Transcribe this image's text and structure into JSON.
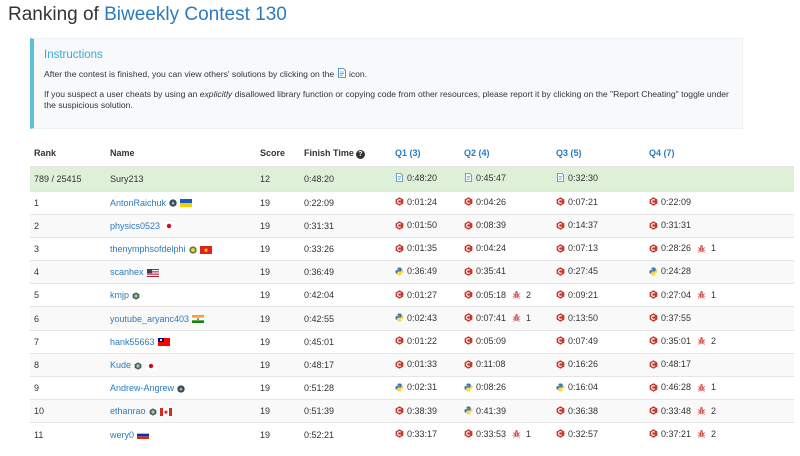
{
  "page": {
    "title_prefix": "Ranking of ",
    "title_contest": "Biweekly Contest 130"
  },
  "instructions": {
    "title": "Instructions",
    "line1_before": "After the contest is finished, you can view others' solutions by clicking on the ",
    "line1_after": " icon.",
    "line2_a": "If you suspect a user cheats by using an ",
    "line2_em": "explicitly",
    "line2_b": " disallowed library function or copying code from other resources, please report it by clicking on the \"Report Cheating\" toggle under the suspicious solution."
  },
  "table": {
    "headers": {
      "rank": "Rank",
      "name": "Name",
      "score": "Score",
      "finish": "Finish Time",
      "q1": "Q1 (3)",
      "q2": "Q2 (4)",
      "q3": "Q3 (5)",
      "q4": "Q4 (7)"
    },
    "current_user": {
      "rank": "789 / 25415",
      "name": "Sury213",
      "score": "12",
      "finish": "0:48:20",
      "q1": "0:48:20",
      "q2": "0:45:47",
      "q3": "0:32:30",
      "q4": ""
    },
    "rows": [
      {
        "rank": "1",
        "name": "AntonRaichuk",
        "score": "19",
        "finish": "0:22:09",
        "q1": {
          "t": "0:01:24",
          "lang": "cpp"
        },
        "q2": {
          "t": "0:04:26",
          "lang": "cpp"
        },
        "q3": {
          "t": "0:07:21",
          "lang": "cpp"
        },
        "q4": {
          "t": "0:22:09",
          "lang": "cpp"
        }
      },
      {
        "rank": "2",
        "name": "physics0523",
        "score": "19",
        "finish": "0:31:31",
        "q1": {
          "t": "0:01:50",
          "lang": "cpp"
        },
        "q2": {
          "t": "0:08:39",
          "lang": "cpp"
        },
        "q3": {
          "t": "0:14:37",
          "lang": "cpp"
        },
        "q4": {
          "t": "0:31:31",
          "lang": "cpp"
        }
      },
      {
        "rank": "3",
        "name": "thenymphsofdelphi",
        "score": "19",
        "finish": "0:33:26",
        "q1": {
          "t": "0:01:35",
          "lang": "cpp"
        },
        "q2": {
          "t": "0:04:24",
          "lang": "cpp"
        },
        "q3": {
          "t": "0:07:13",
          "lang": "cpp"
        },
        "q4": {
          "t": "0:28:26",
          "lang": "cpp",
          "pen": "1"
        }
      },
      {
        "rank": "4",
        "name": "scanhex",
        "score": "19",
        "finish": "0:36:49",
        "q1": {
          "t": "0:36:49",
          "lang": "py"
        },
        "q2": {
          "t": "0:35:41",
          "lang": "cpp"
        },
        "q3": {
          "t": "0:27:45",
          "lang": "cpp"
        },
        "q4": {
          "t": "0:24:28",
          "lang": "py"
        }
      },
      {
        "rank": "5",
        "name": "kmjp",
        "score": "19",
        "finish": "0:42:04",
        "q1": {
          "t": "0:01:27",
          "lang": "cpp"
        },
        "q2": {
          "t": "0:05:18",
          "lang": "cpp",
          "pen": "2"
        },
        "q3": {
          "t": "0:09:21",
          "lang": "cpp"
        },
        "q4": {
          "t": "0:27:04",
          "lang": "cpp",
          "pen": "1"
        }
      },
      {
        "rank": "6",
        "name": "youtube_aryanc403",
        "score": "19",
        "finish": "0:42:55",
        "q1": {
          "t": "0:02:43",
          "lang": "py"
        },
        "q2": {
          "t": "0:07:41",
          "lang": "cpp",
          "pen": "1"
        },
        "q3": {
          "t": "0:13:50",
          "lang": "cpp"
        },
        "q4": {
          "t": "0:37:55",
          "lang": "cpp"
        }
      },
      {
        "rank": "7",
        "name": "hank55663",
        "score": "19",
        "finish": "0:45:01",
        "q1": {
          "t": "0:01:22",
          "lang": "cpp"
        },
        "q2": {
          "t": "0:05:09",
          "lang": "cpp"
        },
        "q3": {
          "t": "0:07:49",
          "lang": "cpp"
        },
        "q4": {
          "t": "0:35:01",
          "lang": "cpp",
          "pen": "2"
        }
      },
      {
        "rank": "8",
        "name": "Kude",
        "score": "19",
        "finish": "0:48:17",
        "q1": {
          "t": "0:01:33",
          "lang": "cpp"
        },
        "q2": {
          "t": "0:11:08",
          "lang": "cpp"
        },
        "q3": {
          "t": "0:16:26",
          "lang": "cpp"
        },
        "q4": {
          "t": "0:48:17",
          "lang": "cpp"
        }
      },
      {
        "rank": "9",
        "name": "Andrew-Angrew",
        "score": "19",
        "finish": "0:51:28",
        "q1": {
          "t": "0:02:31",
          "lang": "py"
        },
        "q2": {
          "t": "0:08:26",
          "lang": "py"
        },
        "q3": {
          "t": "0:16:04",
          "lang": "py"
        },
        "q4": {
          "t": "0:46:28",
          "lang": "cpp",
          "pen": "1"
        }
      },
      {
        "rank": "10",
        "name": "ethanrao",
        "score": "19",
        "finish": "0:51:39",
        "q1": {
          "t": "0:38:39",
          "lang": "cpp"
        },
        "q2": {
          "t": "0:41:39",
          "lang": "py"
        },
        "q3": {
          "t": "0:36:38",
          "lang": "cpp"
        },
        "q4": {
          "t": "0:33:48",
          "lang": "cpp",
          "pen": "2"
        }
      },
      {
        "rank": "11",
        "name": "wery0",
        "score": "19",
        "finish": "0:52:21",
        "q1": {
          "t": "0:33:17",
          "lang": "cpp"
        },
        "q2": {
          "t": "0:33:53",
          "lang": "cpp",
          "pen": "1"
        },
        "q3": {
          "t": "0:32:57",
          "lang": "cpp"
        },
        "q4": {
          "t": "0:37:21",
          "lang": "cpp",
          "pen": "2"
        }
      }
    ]
  },
  "row_badges": {
    "0": [
      "badge-leetcode",
      "flag-ua"
    ],
    "1": [
      "flag-jp"
    ],
    "2": [
      "badge-guardian",
      "flag-vn"
    ],
    "3": [
      "flag-us"
    ],
    "4": [
      "badge-knight"
    ],
    "5": [
      "flag-in"
    ],
    "6": [
      "flag-tw"
    ],
    "7": [
      "badge-knight",
      "flag-jp"
    ],
    "8": [
      "badge-leetcode"
    ],
    "9": [
      "badge-knight",
      "flag-ca"
    ],
    "10": [
      "flag-ru"
    ]
  },
  "colors": {
    "link": "#2b7bc0",
    "highlight_row": "#dff0d8",
    "cpp_icon": "#c0392b",
    "penalty": "#d9534f",
    "instructions_accent": "#5bc0de"
  }
}
